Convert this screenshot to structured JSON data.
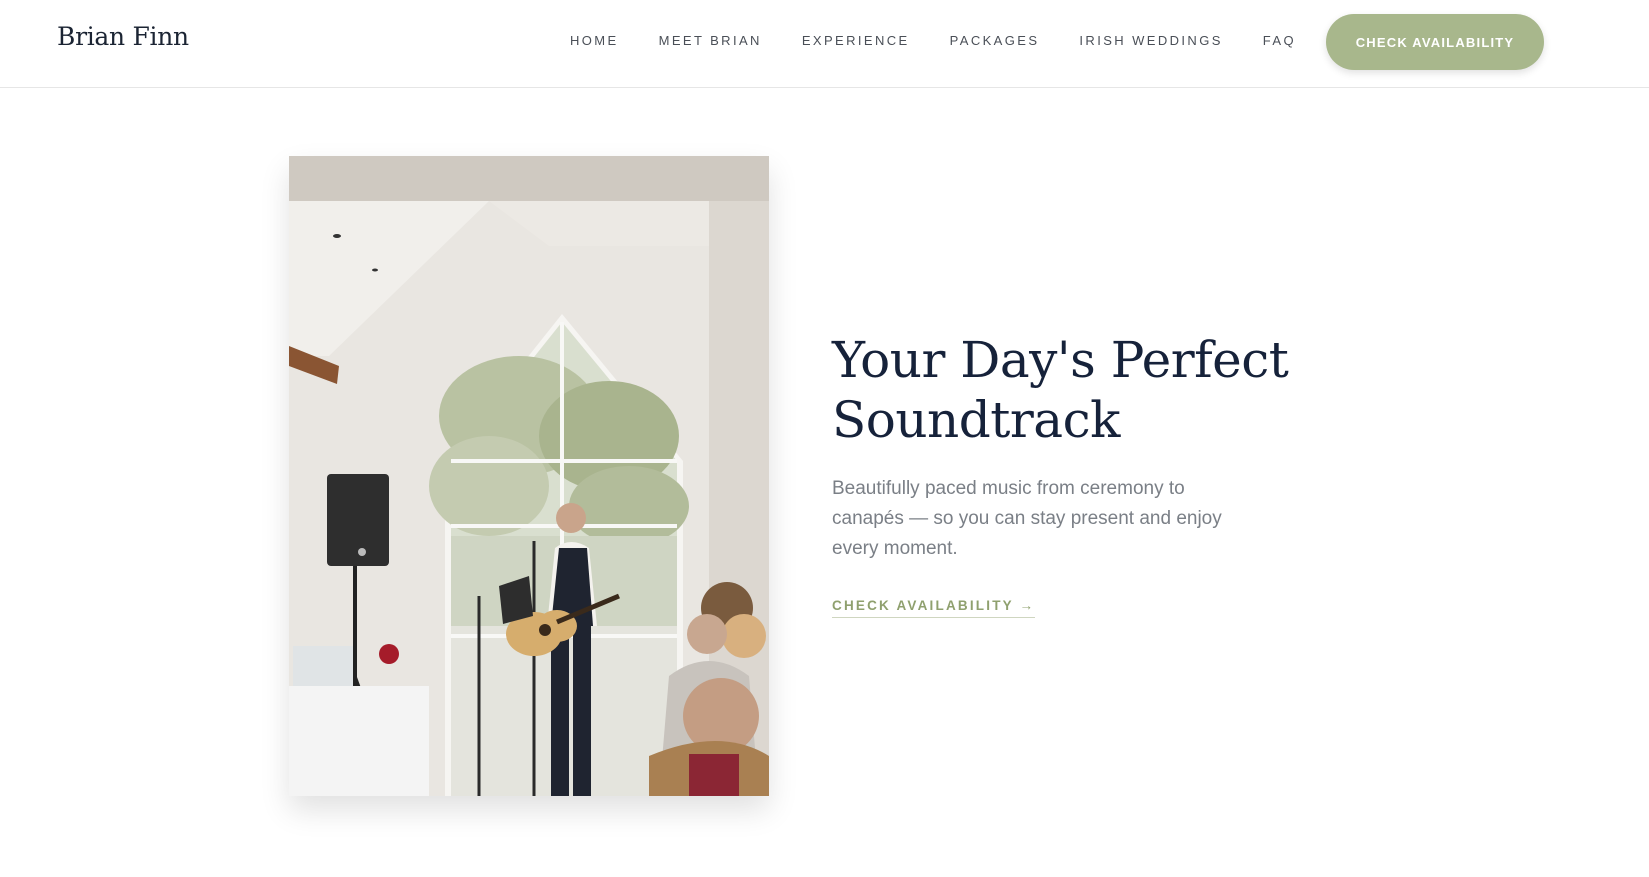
{
  "header": {
    "brand": "Brian Finn",
    "nav": [
      {
        "label": "HOME"
      },
      {
        "label": "MEET BRIAN"
      },
      {
        "label": "EXPERIENCE"
      },
      {
        "label": "PACKAGES"
      },
      {
        "label": "IRISH WEDDINGS"
      },
      {
        "label": "FAQ"
      }
    ],
    "cta_label": "CHECK AVAILABILITY"
  },
  "hero": {
    "title_line1": "Your Day's Perfect",
    "title_line2": "Soundtrack",
    "subtitle": "Beautifully paced music from ceremony to canapés — so you can stay present and enjoy every moment.",
    "link_label": "CHECK AVAILABILITY →",
    "photo_icon": "wedding-guitarist-photo"
  },
  "colors": {
    "accent": "#a8b78c",
    "link": "#8fa06e",
    "title": "#16223a",
    "body_text": "#7a7f86"
  }
}
